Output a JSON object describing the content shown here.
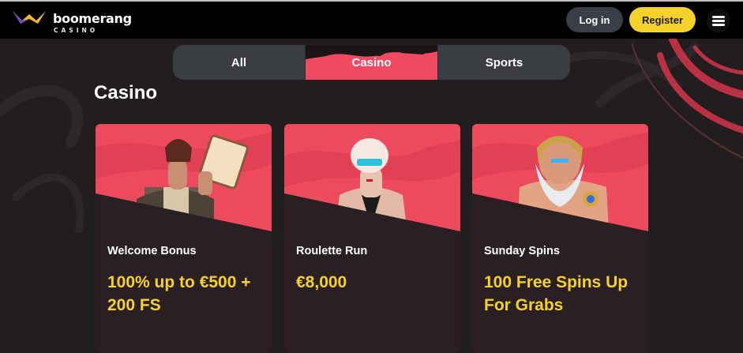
{
  "header": {
    "logo_word": "boomerang",
    "logo_sub": "CASINO",
    "login_label": "Log in",
    "register_label": "Register",
    "menu_icon": "hamburger-menu-icon"
  },
  "tabs": [
    {
      "label": "All",
      "active": false
    },
    {
      "label": "Casino",
      "active": true
    },
    {
      "label": "Sports",
      "active": false
    }
  ],
  "section_title": "Casino",
  "cards": [
    {
      "name": "Welcome Bonus",
      "offer": "100% up to €500 + 200 FS"
    },
    {
      "name": "Roulette Run",
      "offer": "€8,000"
    },
    {
      "name": "Sunday Spins",
      "offer": "100 Free Spins Up For Grabs"
    }
  ],
  "colors": {
    "background": "#221d1f",
    "header": "#000000",
    "accent_red": "#ef4a62",
    "accent_yellow": "#f5d22a",
    "tab_bg": "#3a3d42"
  }
}
